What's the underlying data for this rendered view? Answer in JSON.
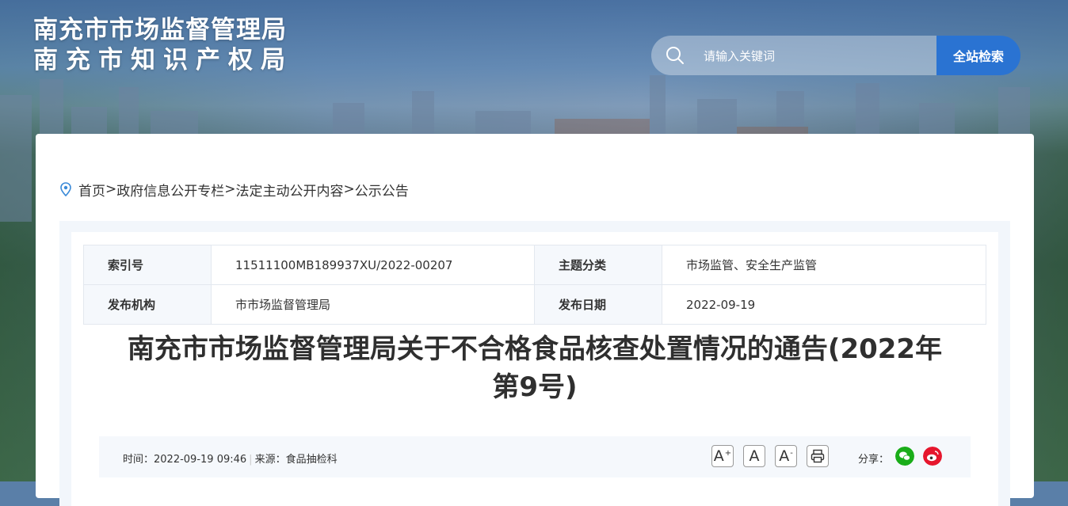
{
  "header": {
    "org_name_1": "南充市市场监督管理局",
    "org_name_2": "南充市知识产权局",
    "search": {
      "placeholder": "请输入关键词",
      "button_label": "全站检索"
    }
  },
  "breadcrumb": [
    "首页",
    "政府信息公开专栏",
    "法定主动公开内容",
    "公示公告"
  ],
  "breadcrumb_sep": ">",
  "meta": {
    "index_label": "索引号",
    "index_value": "11511100MB189937XU/2022-00207",
    "topic_label": "主题分类",
    "topic_value": "市场监管、安全生产监管",
    "publisher_label": "发布机构",
    "publisher_value": "市市场监督管理局",
    "date_label": "发布日期",
    "date_value": "2022-09-19"
  },
  "article": {
    "title_line1": "南充市市场监督管理局关于不合格食品核查处置情况的通告(2022年",
    "title_line2": "第9号)",
    "time_label": "时间：",
    "time_value": "2022-09-19 09:46",
    "source_label": "来源：",
    "source_value": "食品抽检科",
    "share_label": "分享："
  },
  "tools": {
    "font_large": "A",
    "font_normal": "A",
    "font_small": "A",
    "sup_plus": "+",
    "sup_minus": "-"
  },
  "colors": {
    "accent": "#2a73d2",
    "wechat": "#1aad19",
    "weibo": "#e6162d"
  },
  "icons": [
    "search-icon",
    "location-pin-icon",
    "print-icon",
    "wechat-icon",
    "weibo-icon"
  ]
}
